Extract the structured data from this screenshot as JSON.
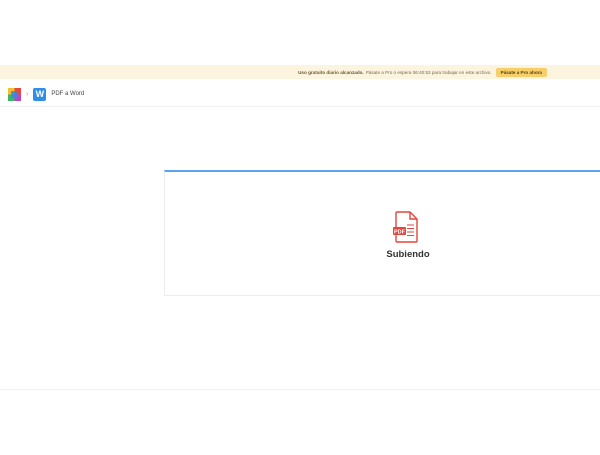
{
  "banner": {
    "bold_text": "Uso gratuito diario alcanzado.",
    "message": "Pásate a Pro o espera 06:40:53 para trabajar en este archivo.",
    "cta_label": "Pásate a Pro ahora"
  },
  "breadcrumb": {
    "app_icon": "multicolor-logo-icon",
    "separator": "›",
    "tool_icon_letter": "W",
    "tool_name": "PDF a Word"
  },
  "upload": {
    "file_icon": "pdf-file-icon",
    "file_icon_badge": "PDF",
    "status": "Subiendo"
  },
  "colors": {
    "accent_blue": "#5aa5ee",
    "banner_bg": "#fdf4e0",
    "cta_bg": "#f6cf6a",
    "pdf_red": "#e2463c"
  }
}
